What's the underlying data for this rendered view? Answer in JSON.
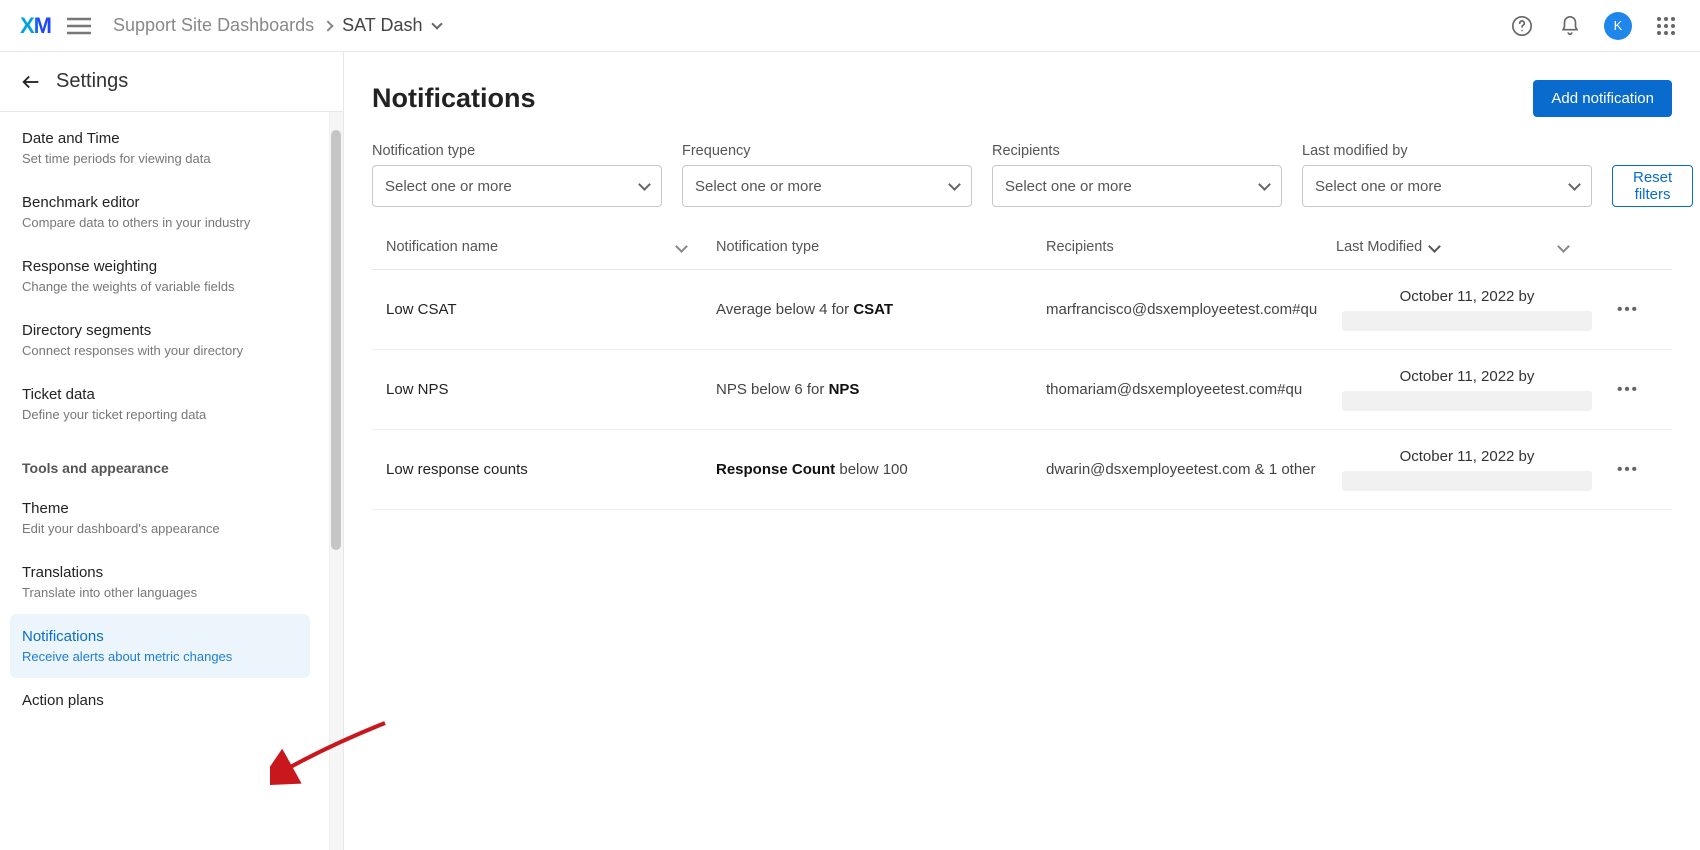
{
  "topbar": {
    "logo": "XM",
    "breadcrumb_parent": "Support Site Dashboards",
    "breadcrumb_current": "SAT Dash",
    "avatar_initial": "K"
  },
  "sidebar": {
    "back_label": "Settings",
    "section_label": "Tools and appearance",
    "items": [
      {
        "t": "Date and Time",
        "d": "Set time periods for viewing data"
      },
      {
        "t": "Benchmark editor",
        "d": "Compare data to others in your industry"
      },
      {
        "t": "Response weighting",
        "d": "Change the weights of variable fields"
      },
      {
        "t": "Directory segments",
        "d": "Connect responses with your directory"
      },
      {
        "t": "Ticket data",
        "d": "Define your ticket reporting data"
      }
    ],
    "tool_items": [
      {
        "t": "Theme",
        "d": "Edit your dashboard's appearance"
      },
      {
        "t": "Translations",
        "d": "Translate into other languages"
      },
      {
        "t": "Notifications",
        "d": "Receive alerts about metric changes"
      },
      {
        "t": "Action plans",
        "d": ""
      }
    ]
  },
  "main": {
    "title": "Notifications",
    "add_button": "Add notification",
    "reset_button": "Reset filters",
    "filters": [
      {
        "label": "Notification type",
        "placeholder": "Select one or more"
      },
      {
        "label": "Frequency",
        "placeholder": "Select one or more"
      },
      {
        "label": "Recipients",
        "placeholder": "Select one or more"
      },
      {
        "label": "Last modified by",
        "placeholder": "Select one or more"
      }
    ],
    "columns": {
      "name": "Notification name",
      "type": "Notification type",
      "recipients": "Recipients",
      "modified": "Last Modified"
    },
    "rows": [
      {
        "name": "Low CSAT",
        "type_pre": "Average below 4 for ",
        "type_bold": "CSAT",
        "type_post": "",
        "recipients": "marfrancisco@dsxemployeetest.com#qu",
        "modified": "October 11, 2022 by"
      },
      {
        "name": "Low NPS",
        "type_pre": "NPS below 6 for ",
        "type_bold": "NPS",
        "type_post": "",
        "recipients": "thomariam@dsxemployeetest.com#qu",
        "modified": "October 11, 2022 by"
      },
      {
        "name": "Low response counts",
        "type_pre": "",
        "type_bold": "Response Count",
        "type_post": " below 100",
        "recipients": "dwarin@dsxemployeetest.com & 1 other",
        "modified": "October 11, 2022 by"
      }
    ]
  }
}
